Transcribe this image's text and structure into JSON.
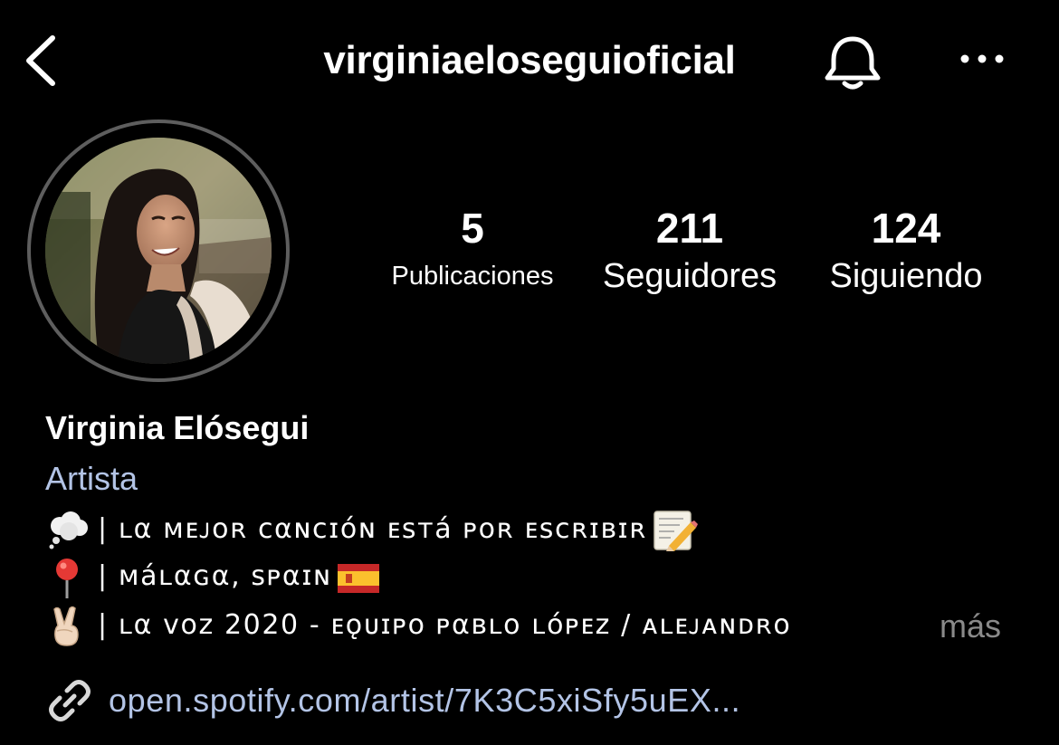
{
  "header": {
    "username": "virginiaeloseguioficial",
    "back_icon": "chevron-left-icon",
    "bell_icon": "bell-icon",
    "more_icon": "ellipsis-icon"
  },
  "stats": {
    "posts_count": "5",
    "posts_label": "Publicaciones",
    "followers_count": "211",
    "followers_label": "Seguidores",
    "following_count": "124",
    "following_label": "Siguiendo"
  },
  "profile": {
    "display_name": "Virginia Elósegui",
    "category": "Artista",
    "bio": [
      {
        "emoji": "thought-balloon-icon",
        "text": "| ʟα ᴍᴇᴊᴏʀ ᴄαɴᴄɪóɴ ᴇsтá ᴘᴏʀ ᴇsᴄʀɪʙɪʀ",
        "trail": "memo-icon"
      },
      {
        "emoji": "round-pushpin-icon",
        "text": "| ᴍáʟαɢα, sᴘαɪɴ",
        "trail": "spain-flag-icon"
      },
      {
        "emoji": "victory-hand-icon",
        "text": "| ʟα ᴠᴏᴢ 2020 - ᴇǫᴜɪᴘᴏ ᴘαʙʟᴏ ʟóᴘᴇᴢ / ᴀʟᴇᴊᴀɴᴅʀᴏ",
        "trail": ""
      }
    ],
    "more_label": "más",
    "link_text": "open.spotify.com/artist/7K3C5xiSfy5uEX...",
    "link_icon": "link-icon"
  },
  "colors": {
    "background": "#000000",
    "text": "#ffffff",
    "link": "#b3c4e6",
    "muted": "#8a8a8a",
    "avatar_ring": "#5e5e5e"
  }
}
